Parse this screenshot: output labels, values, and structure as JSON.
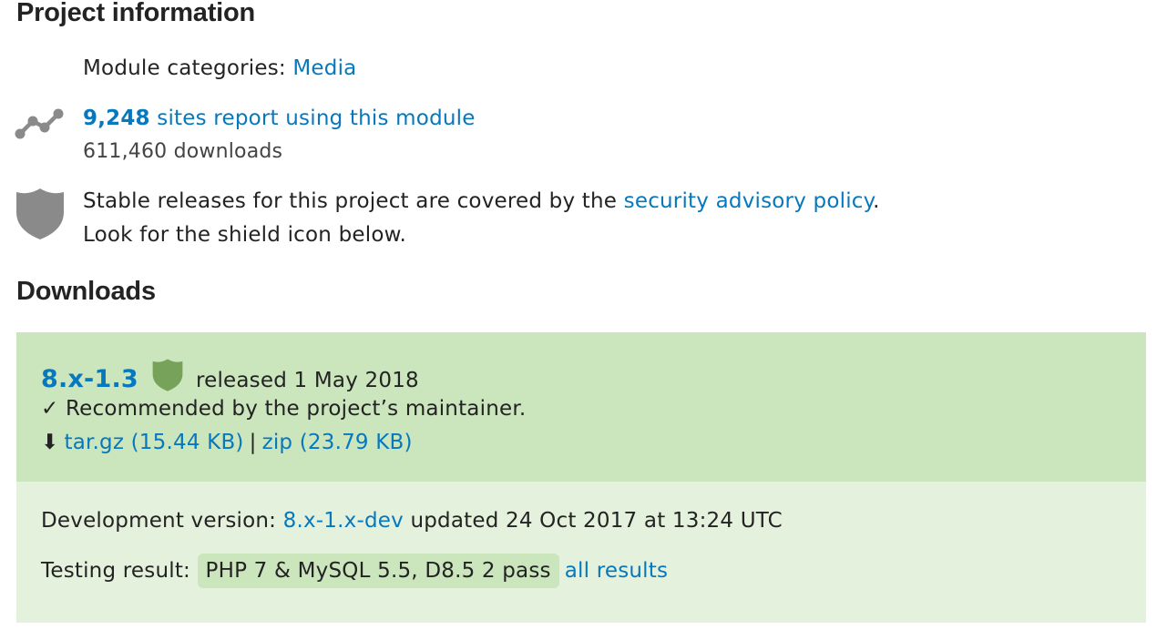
{
  "project_info": {
    "heading": "Project information",
    "categories_label": "Module categories:",
    "categories_link": "Media",
    "usage_count": "9,248",
    "usage_text": " sites report using this module",
    "downloads_text": "611,460 downloads",
    "security_text_before": "Stable releases for this project are covered by the ",
    "security_link": "security advisory policy",
    "security_text_after": ".",
    "security_line2": "Look for the shield icon below."
  },
  "downloads": {
    "heading": "Downloads",
    "recommended": {
      "version": "8.x-1.3",
      "released": "released 1 May 2018",
      "check": "✓",
      "recommended_text": "Recommended by the project’s maintainer.",
      "download_icon": "⬇",
      "targz_label": "tar.gz (15.44 KB)",
      "separator": "|",
      "zip_label": "zip (23.79 KB)"
    },
    "development": {
      "label": "Development version: ",
      "version_link": "8.x-1.x-dev",
      "updated": " updated 24 Oct 2017 at 13:24 UTC",
      "testing_label": "Testing result: ",
      "testing_pill": "PHP 7 & MySQL 5.5, D8.5 2 pass",
      "all_results": "all results"
    }
  },
  "icons": {
    "usage": "usage-trend-icon",
    "security": "shield-icon",
    "release_shield": "shield-icon"
  },
  "colors": {
    "link": "#0678be",
    "recommended_bg": "#cbe5bd",
    "development_bg": "#e4f1dc",
    "shield_gray": "#8a8a8a",
    "shield_green": "#77a25a"
  }
}
